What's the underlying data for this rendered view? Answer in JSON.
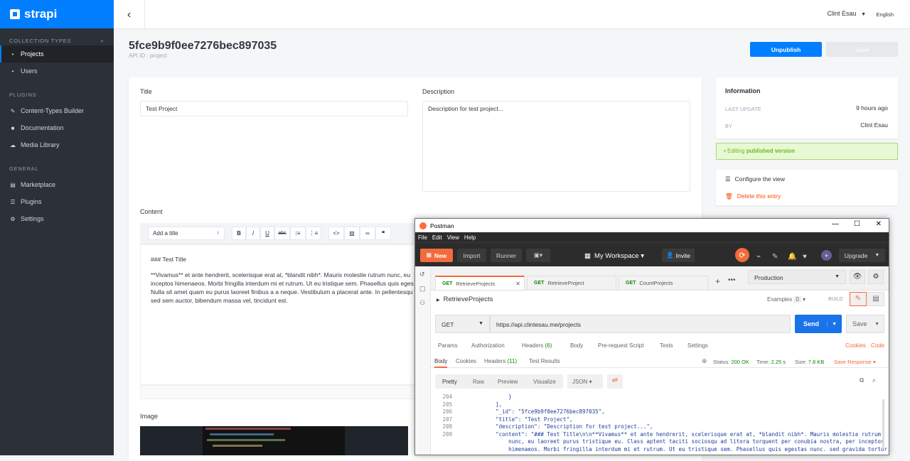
{
  "sidebar": {
    "brand": "strapi",
    "collection_types_label": "COLLECTION TYPES",
    "collection_items": [
      {
        "label": "Projects",
        "icon": "bullet"
      },
      {
        "label": "Users",
        "icon": "bullet"
      }
    ],
    "plugins_label": "PLUGINS",
    "plugin_items": [
      {
        "label": "Content-Types Builder"
      },
      {
        "label": "Documentation"
      },
      {
        "label": "Media Library"
      }
    ],
    "general_label": "GENERAL",
    "general_items": [
      {
        "label": "Marketplace"
      },
      {
        "label": "Plugins"
      },
      {
        "label": "Settings"
      }
    ]
  },
  "header": {
    "user": "Clint Esau",
    "language": "English"
  },
  "page": {
    "title": "5fce9b9f0ee7276bec897035",
    "api_id": "API ID : project",
    "unpublish_label": "Unpublish",
    "save_label": "Save"
  },
  "form": {
    "title_label": "Title",
    "title_value": "Test Project",
    "description_label": "Description",
    "description_value": "Description for test project...",
    "content_label": "Content",
    "toolbar_select": "Add a title",
    "content_line1": "### Test Title",
    "content_line2": "**Vivamus** et ante hendrerit, scelerisque erat at, *blandit nibh*. Mauris molestie rutrum nunc, eu",
    "content_line3": "inceptos himenaeos. Morbi fringilla interdum mi et rutrum. Ut eu tristique sem. Phasellus quis eges",
    "content_line4": "Nulla sit amet quam eu purus laoreet finibus a a neque. Vestibulum a placerat ante. In pellentesqu",
    "content_line5": "sed sem auctor, bibendum massa vel, tincidunt est.",
    "image_label": "Image"
  },
  "info": {
    "heading": "Information",
    "last_update_label": "LAST UPDATE",
    "last_update_value": "9 hours ago",
    "by_label": "BY",
    "by_value": "Clint Esau",
    "editing_prefix": "Editing ",
    "editing_strong": "published version",
    "configure_label": "Configure the view",
    "delete_label": "Delete this entry"
  },
  "postman": {
    "window_title": "Postman",
    "menu": [
      "File",
      "Edit",
      "View",
      "Help"
    ],
    "new_label": "New",
    "import_label": "Import",
    "runner_label": "Runner",
    "workspace_label": "My Workspace",
    "invite_label": "Invite",
    "upgrade_label": "Upgrade",
    "tabs": [
      {
        "method": "GET",
        "name": "RetrieveProjects"
      },
      {
        "method": "GET",
        "name": "RetrieveProject"
      },
      {
        "method": "GET",
        "name": "CountProjects"
      }
    ],
    "environment": "Production",
    "request_name": "RetrieveProjects",
    "examples_label": "Examples",
    "examples_count": "0",
    "build_label": "BUILD",
    "method": "GET",
    "url": "https://api.clintesau.me/projects",
    "send_label": "Send",
    "save_label": "Save",
    "req_tabs": [
      "Params",
      "Authorization",
      "Headers",
      "Body",
      "Pre-request Script",
      "Tests",
      "Settings"
    ],
    "headers_count": "(6)",
    "cookies_label": "Cookies",
    "code_label": "Code",
    "resp_tabs": [
      "Body",
      "Cookies",
      "Headers",
      "Test Results"
    ],
    "resp_headers_count": "(11)",
    "status_label": "Status:",
    "status_value": "200 OK",
    "time_label": "Time:",
    "time_value": "2.25 s",
    "size_label": "Size:",
    "size_value": "7.8 KB",
    "save_response_label": "Save Response",
    "view_tabs": [
      "Pretty",
      "Raw",
      "Preview",
      "Visualize"
    ],
    "format": "JSON",
    "code_lines": [
      {
        "n": "204",
        "t": "            }"
      },
      {
        "n": "205",
        "t": "        ],"
      },
      {
        "n": "206",
        "t": "        \"_id\": \"5fce9b9f0ee7276bec897035\","
      },
      {
        "n": "207",
        "t": "        \"title\": \"Test Project\","
      },
      {
        "n": "208",
        "t": "        \"description\": \"Description for test project...\","
      },
      {
        "n": "209",
        "t": "        \"content\": \"### Test Title\\n\\n**Vivamus** et ante hendrerit, scelerisque erat at, *blandit nibh*. Mauris molestie rutrum"
      },
      {
        "n": "",
        "t": "            nunc, eu laoreet purus tristique eu. Class aptent taciti sociosqu ad litora torquent per conubia nostra, per inceptos"
      },
      {
        "n": "",
        "t": "            himenaeos. Morbi fringilla interdum mi et rutrum. Ut eu tristique sem. Phasellus quis egestas nunc. sed gravida tortor."
      }
    ]
  }
}
